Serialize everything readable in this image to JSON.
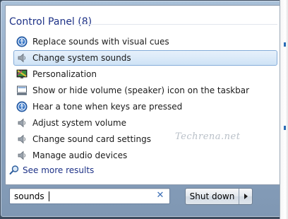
{
  "search_results": {
    "section_title": "Control Panel (8)",
    "items": [
      {
        "label": "Replace sounds with visual cues",
        "icon": "ease-of-access-icon",
        "selected": false
      },
      {
        "label": "Change system sounds",
        "icon": "speaker-icon",
        "selected": true
      },
      {
        "label": "Personalization",
        "icon": "personalization-icon",
        "selected": false
      },
      {
        "label": "Show or hide volume (speaker) icon on the taskbar",
        "icon": "notification-area-icon",
        "selected": false
      },
      {
        "label": "Hear a tone when keys are pressed",
        "icon": "ease-of-access-icon",
        "selected": false
      },
      {
        "label": "Adjust system volume",
        "icon": "speaker-icon",
        "selected": false
      },
      {
        "label": "Change sound card settings",
        "icon": "speaker-icon",
        "selected": false
      },
      {
        "label": "Manage audio devices",
        "icon": "speaker-icon",
        "selected": false
      }
    ],
    "see_more_label": "See more results"
  },
  "watermark": "Techrena.net",
  "search": {
    "value": "sounds"
  },
  "shutdown": {
    "label": "Shut down"
  },
  "colors": {
    "section_title": "#1e3287",
    "selection_border": "#84acd8",
    "clear_icon": "#3b6eb5"
  }
}
